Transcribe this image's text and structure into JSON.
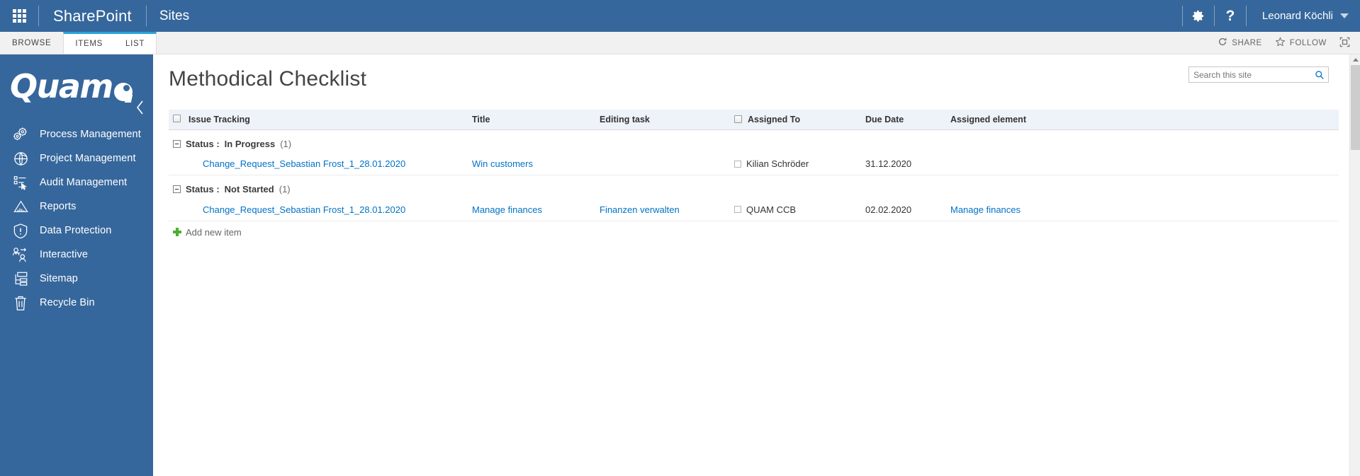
{
  "suite": {
    "waffle_label": "app-launcher",
    "brand": "SharePoint",
    "site": "Sites",
    "settings_label": "Settings",
    "help_label": "Help",
    "user_name": "Leonard Köchli"
  },
  "ribbon": {
    "tabs": [
      {
        "label": "BROWSE",
        "selected": false
      },
      {
        "label": "ITEMS",
        "selected": true
      },
      {
        "label": "LIST",
        "selected": true
      }
    ],
    "actions": [
      {
        "label": "SHARE",
        "icon": "share-icon"
      },
      {
        "label": "FOLLOW",
        "icon": "star-icon"
      },
      {
        "label": "",
        "icon": "focus-on-content-icon"
      }
    ]
  },
  "sidebar": {
    "logo_text": "Quam",
    "collapse_label": "Collapse navigation",
    "items": [
      {
        "label": "Process Management",
        "icon": "gears-icon"
      },
      {
        "label": "Project Management",
        "icon": "globe-icon"
      },
      {
        "label": "Audit Management",
        "icon": "checklist-cursor-icon"
      },
      {
        "label": "Reports",
        "icon": "chart-mountain-icon"
      },
      {
        "label": "Data Protection",
        "icon": "shield-alert-icon"
      },
      {
        "label": "Interactive",
        "icon": "people-exchange-icon"
      },
      {
        "label": "Sitemap",
        "icon": "sitemap-icon"
      },
      {
        "label": "Recycle Bin",
        "icon": "trash-icon"
      }
    ]
  },
  "main": {
    "page_title": "Methodical Checklist",
    "search": {
      "placeholder": "Search this site",
      "value": "",
      "icon": "search-icon"
    },
    "table": {
      "select_all_label": "select-all",
      "columns": [
        {
          "key": "check",
          "label": ""
        },
        {
          "key": "issue",
          "label": "Issue Tracking"
        },
        {
          "key": "title",
          "label": "Title"
        },
        {
          "key": "edit",
          "label": "Editing task"
        },
        {
          "key": "assigned",
          "label": "Assigned To"
        },
        {
          "key": "due",
          "label": "Due Date"
        },
        {
          "key": "element",
          "label": "Assigned element"
        }
      ],
      "groups": [
        {
          "field": "Status :",
          "value": "In Progress",
          "count": "(1)",
          "rows": [
            {
              "issue": "Change_Request_Sebastian Frost_1_28.01.2020",
              "title": "Win customers",
              "edit": "",
              "assigned": "Kilian Schröder",
              "due": "31.12.2020",
              "element": ""
            }
          ]
        },
        {
          "field": "Status :",
          "value": "Not Started",
          "count": "(1)",
          "rows": [
            {
              "issue": "Change_Request_Sebastian Frost_1_28.01.2020",
              "title": "Manage finances",
              "edit": "Finanzen verwalten",
              "assigned": "QUAM CCB",
              "due": "02.02.2020",
              "element": "Manage finances"
            }
          ]
        }
      ],
      "add_new_label": "Add new item"
    }
  },
  "colors": {
    "suite_blue": "#36679c",
    "accent_teal": "#27a5d8",
    "link_blue": "#0072c6",
    "header_row": "#eef2f9",
    "add_green": "#4caf2f"
  }
}
